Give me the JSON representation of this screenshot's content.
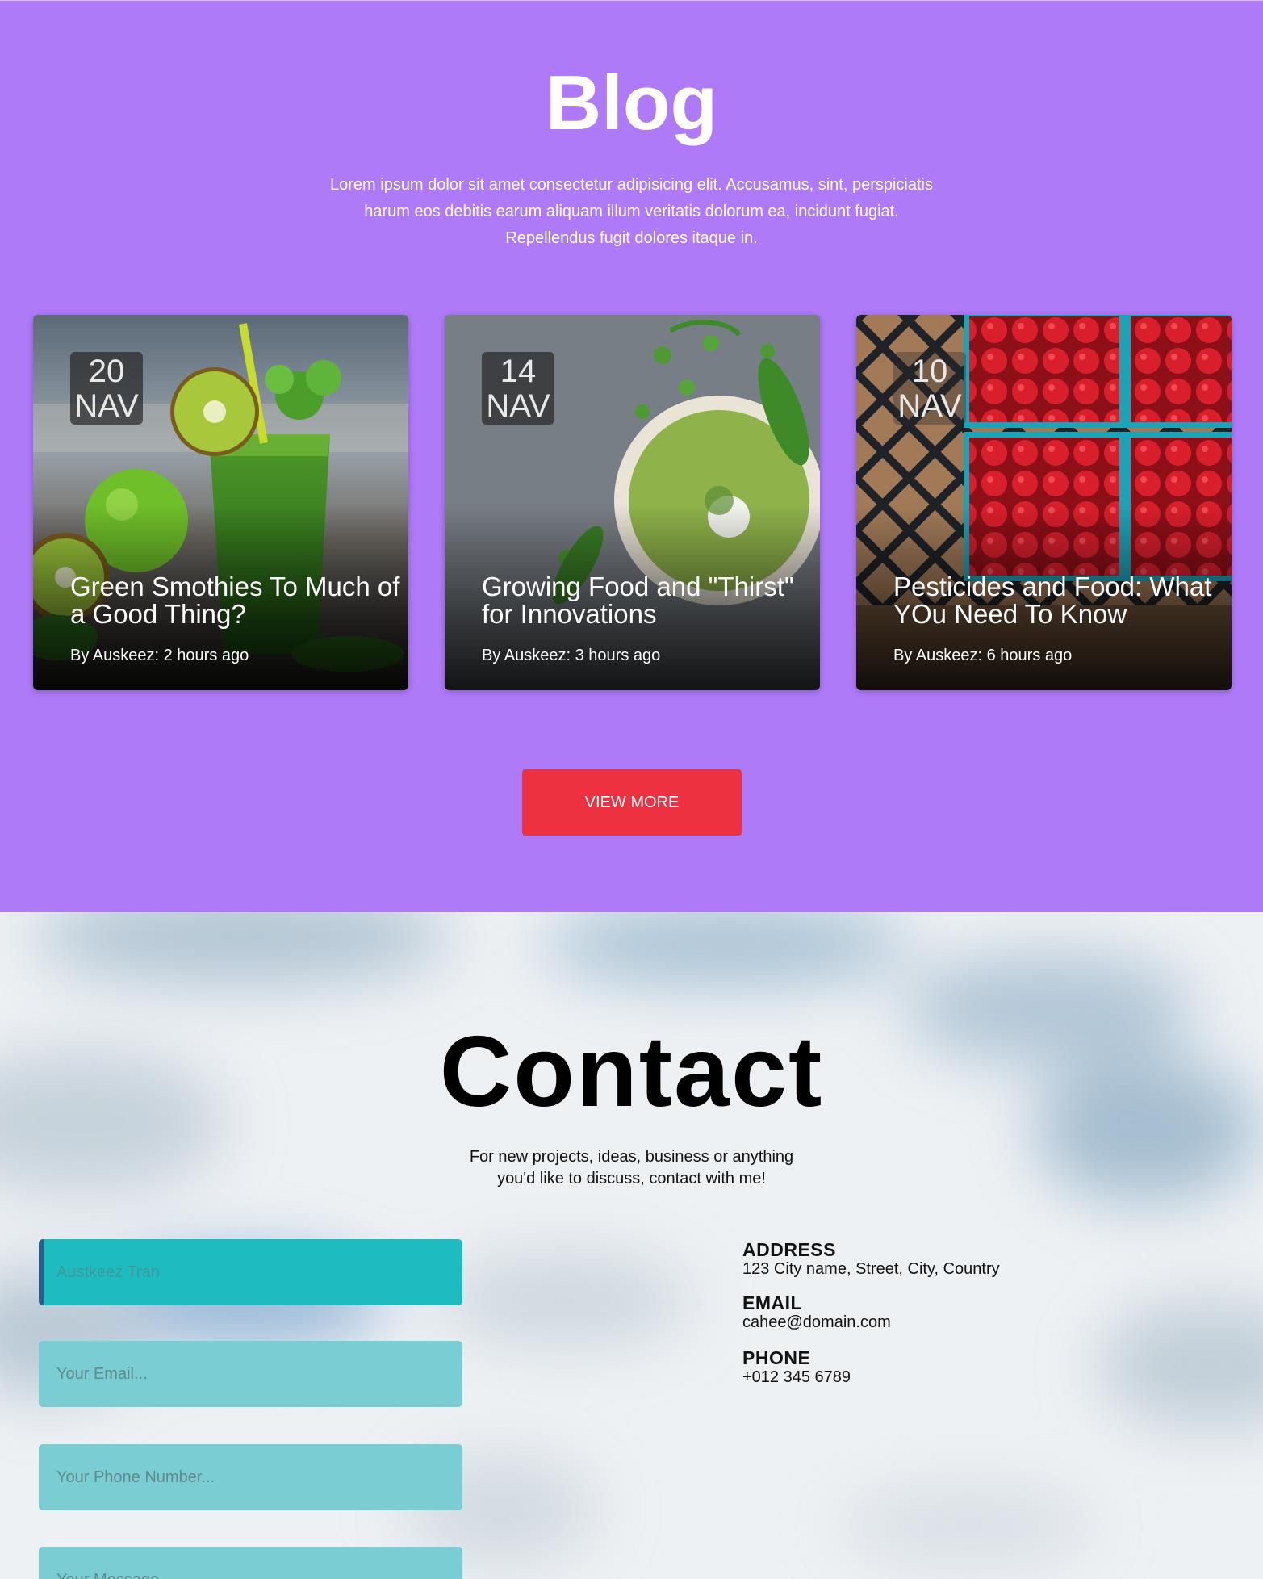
{
  "blog": {
    "title": "Blog",
    "intro": "Lorem ipsum dolor sit amet consectetur adipisicing elit. Accusamus, sint, perspiciatis harum eos debitis earum aliquam illum veritatis dolorum ea, incidunt fugiat. Repellendus fugit dolores itaque in.",
    "posts": [
      {
        "day": "20",
        "month": "NAV",
        "title": "Green Smothies To Much of a Good Thing?",
        "byline": "By Auskeez: 2 hours ago"
      },
      {
        "day": "14",
        "month": "NAV",
        "title": "Growing Food and \"Thirst\" for Innovations",
        "byline": "By Auskeez: 3 hours ago"
      },
      {
        "day": "10",
        "month": "NAV",
        "title": "Pesticides and Food: What YOu Need To Know",
        "byline": "By Auskeez: 6 hours ago"
      }
    ],
    "view_more_label": "VIEW MORE"
  },
  "contact": {
    "title": "Contact",
    "intro": "For new projects, ideas, business or anything you'd like to discuss, contact with me!",
    "form": {
      "name_placeholder": "Austkeez Tran",
      "email_placeholder": "Your Email...",
      "phone_placeholder": "Your Phone Number...",
      "message_placeholder": "Your Message..."
    },
    "info": {
      "address_label": "ADDRESS",
      "address_value": "123 City name, Street, City, Country",
      "email_label": "EMAIL",
      "email_value": "cahee@domain.com",
      "phone_label": "PHONE",
      "phone_value": "+012 345 6789"
    }
  },
  "colors": {
    "blog_bg": "#af7af8",
    "button_red": "#ee3140",
    "field_teal": "#79cdd3",
    "field_active": "#1ebcc0"
  },
  "icons": [
    "smoothie-photo",
    "pea-soup-photo",
    "raspberries-photo"
  ]
}
